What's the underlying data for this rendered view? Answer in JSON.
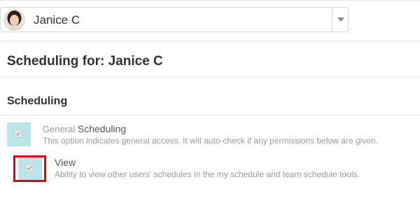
{
  "user_selector": {
    "name": "Janice C",
    "avatar_icon": "user-photo"
  },
  "header": {
    "title": "Scheduling for: Janice C"
  },
  "section": {
    "title": "Scheduling"
  },
  "permissions": [
    {
      "prefix": "General",
      "name": "Scheduling",
      "description": "This option indicates general access. It will auto-check if any permissions below are given.",
      "checked": true
    },
    {
      "prefix": "",
      "name": "View",
      "description": "Ability to view other users' schedules in the my schedule and team schedule tools.",
      "checked": true
    }
  ],
  "colors": {
    "checkbox_bg": "#b8e6eb",
    "highlight": "#e0000f",
    "muted_text": "#9a9a9a"
  }
}
